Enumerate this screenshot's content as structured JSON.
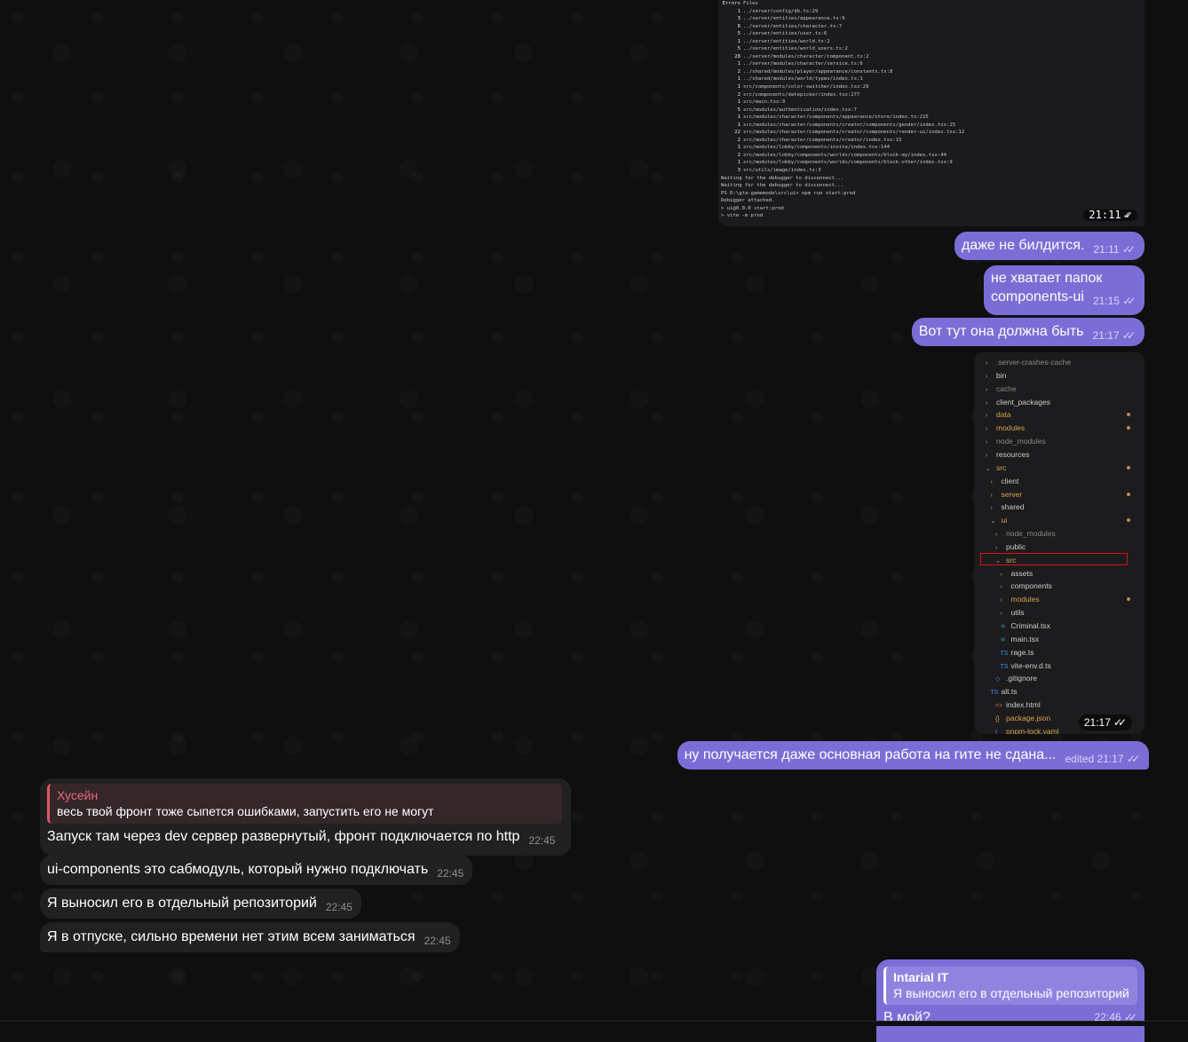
{
  "terminal": {
    "lines": [
      {
        "num": "Errors",
        "text": "Files"
      },
      {
        "num": "1",
        "text": "../server/config/db.ts:29"
      },
      {
        "num": "3",
        "text": "../server/entities/appearance.ts:9"
      },
      {
        "num": "8",
        "text": "../server/entities/character.ts:7"
      },
      {
        "num": "5",
        "text": "../server/entities/user.ts:6"
      },
      {
        "num": "1",
        "text": "../server/entities/world.ts:2"
      },
      {
        "num": "5",
        "text": "../server/entities/world_users.ts:2"
      },
      {
        "num": "28",
        "text": "../server/modules/character/component.ts:2"
      },
      {
        "num": "1",
        "text": "../server/modules/character/service.ts:6"
      },
      {
        "num": "2",
        "text": "../shared/modules/player/appearance/constants.ts:8"
      },
      {
        "num": "1",
        "text": "../shared/modules/world/types/index.ts:1"
      },
      {
        "num": "1",
        "text": "src/components/color-switcher/index.tsx:29"
      },
      {
        "num": "2",
        "text": "src/components/datepicker/index.tsx:277"
      },
      {
        "num": "1",
        "text": "src/main.tsx:9"
      },
      {
        "num": "5",
        "text": "src/modules/authentication/index.tsx:7"
      },
      {
        "num": "1",
        "text": "src/modules/character/components/appearance/store/index.ts:215"
      },
      {
        "num": "1",
        "text": "src/modules/character/components/creator/components/gender/index.tsx:25"
      },
      {
        "num": "22",
        "text": "src/modules/character/components/creator/components/render-ui/index.tsx:12"
      },
      {
        "num": "2",
        "text": "src/modules/character/components/creator/index.tsx:15"
      },
      {
        "num": "1",
        "text": "src/modules/lobby/components/invite/index.tsx:144"
      },
      {
        "num": "2",
        "text": "src/modules/lobby/components/worlds/components/block-my/index.tsx:44"
      },
      {
        "num": "1",
        "text": "src/modules/lobby/components/worlds/components/block-other/index.tsx:9"
      },
      {
        "num": "3",
        "text": "src/utils/image/index.ts:3"
      },
      {
        "num": "",
        "text": "Waiting for the debugger to disconnect..."
      },
      {
        "num": "",
        "text": "Waiting for the debugger to disconnect..."
      },
      {
        "num": "",
        "text": "PS D:\\gta-gamemode\\src\\ui> npm run start:prod"
      },
      {
        "num": "",
        "text": "Debugger attached."
      },
      {
        "num": "",
        "text": ""
      },
      {
        "num": "",
        "text": "> ui@0.0.0 start:prod"
      },
      {
        "num": "",
        "text": "> vite -m prod"
      }
    ],
    "time": "21:11"
  },
  "messages_out": [
    {
      "text": "даже не билдится.",
      "time": "21:11"
    },
    {
      "text": "не хватает папок components-ui",
      "line1": "не хватает папок",
      "line2": "components-ui",
      "time": "21:15"
    },
    {
      "text": "Вот тут она должна быть",
      "time": "21:17"
    }
  ],
  "tree": {
    "time": "21:17",
    "items": [
      {
        "label": ".server-crashes-cache",
        "type": "folder",
        "color": "#8a8a8a",
        "dot": false
      },
      {
        "label": "bin",
        "type": "folder",
        "color": "#cccccc",
        "dot": false
      },
      {
        "label": "cache",
        "type": "folder",
        "color": "#8a8a8a",
        "dot": false
      },
      {
        "label": "client_packages",
        "type": "folder",
        "color": "#cccccc",
        "dot": false
      },
      {
        "label": "data",
        "type": "folder",
        "color": "#d6a44e",
        "dot": true
      },
      {
        "label": "modules",
        "type": "folder",
        "color": "#d6a44e",
        "dot": true
      },
      {
        "label": "node_modules",
        "type": "folder",
        "color": "#8a8a8a",
        "dot": false
      },
      {
        "label": "resources",
        "type": "folder",
        "color": "#cccccc",
        "dot": false
      },
      {
        "label": "src",
        "type": "open",
        "color": "#d6a44e",
        "dot": true
      },
      {
        "label": "client",
        "type": "folder",
        "color": "#cccccc",
        "dot": false
      },
      {
        "label": "server",
        "type": "folder",
        "color": "#d6a44e",
        "dot": true
      },
      {
        "label": "shared",
        "type": "folder",
        "color": "#cccccc",
        "dot": false
      },
      {
        "label": "ui",
        "type": "open",
        "color": "#d6a44e",
        "dot": true
      },
      {
        "label": "node_modules",
        "type": "folder",
        "color": "#8a8a8a",
        "dot": false
      },
      {
        "label": "public",
        "type": "folder",
        "color": "#cccccc",
        "dot": false
      },
      {
        "label": "src",
        "type": "open",
        "color": "#d6a44e",
        "dot": false
      },
      {
        "label": "assets",
        "type": "folder",
        "color": "#cccccc",
        "dot": false
      },
      {
        "label": "components",
        "type": "folder",
        "color": "#cccccc",
        "dot": false
      },
      {
        "label": "modules",
        "type": "folder",
        "color": "#d6a44e",
        "dot": true
      },
      {
        "label": "utils",
        "type": "folder",
        "color": "#cccccc",
        "dot": false
      },
      {
        "label": "Criminal.tsx",
        "type": "react",
        "color": "#cccccc",
        "dot": false
      },
      {
        "label": "main.tsx",
        "type": "react",
        "color": "#cccccc",
        "dot": false
      },
      {
        "label": "rage.ts",
        "type": "ts",
        "color": "#cccccc",
        "dot": false
      },
      {
        "label": "vite-env.d.ts",
        "type": "ts",
        "color": "#cccccc",
        "dot": false
      },
      {
        "label": ".gitignore",
        "type": "git",
        "color": "#cccccc",
        "dot": false
      },
      {
        "label": "alt.ts",
        "type": "ts",
        "color": "#cccccc",
        "dot": false
      },
      {
        "label": "index.html",
        "type": "html",
        "color": "#cccccc",
        "dot": false
      },
      {
        "label": "package.json",
        "type": "json",
        "color": "#d6a44e",
        "dot": false
      },
      {
        "label": "pnpm-lock.yaml",
        "type": "yaml",
        "color": "#d6a44e",
        "dot": false
      }
    ]
  },
  "edited_message": {
    "text": "ну получается даже основная работа на гите не сдана...",
    "edited": "edited",
    "time": "21:17"
  },
  "reply_in": {
    "quote_name": "Хусейн",
    "quote_text": "весь твой фронт тоже сыпется ошибками, запустить его не могут",
    "text": "Запуск там через dev сервер развернутый, фронт подключается по http",
    "time": "22:45"
  },
  "messages_in": [
    {
      "text": "ui-components это сабмодуль, который нужно подключать",
      "time": "22:45"
    },
    {
      "text": "Я выносил его в отдельный репозиторий",
      "time": "22:45"
    },
    {
      "text": "Я в отпуске, сильно времени нет этим всем заниматься",
      "time": "22:45"
    }
  ],
  "reply_out": {
    "quote_name": "Intarial IT",
    "quote_text": "Я выносил его в отдельный репозиторий",
    "text": "В мой?",
    "time": "22:46"
  },
  "colors": {
    "outgoing": "#7a6ed6",
    "incoming": "#212121",
    "quote_accent": "#e2556b"
  }
}
